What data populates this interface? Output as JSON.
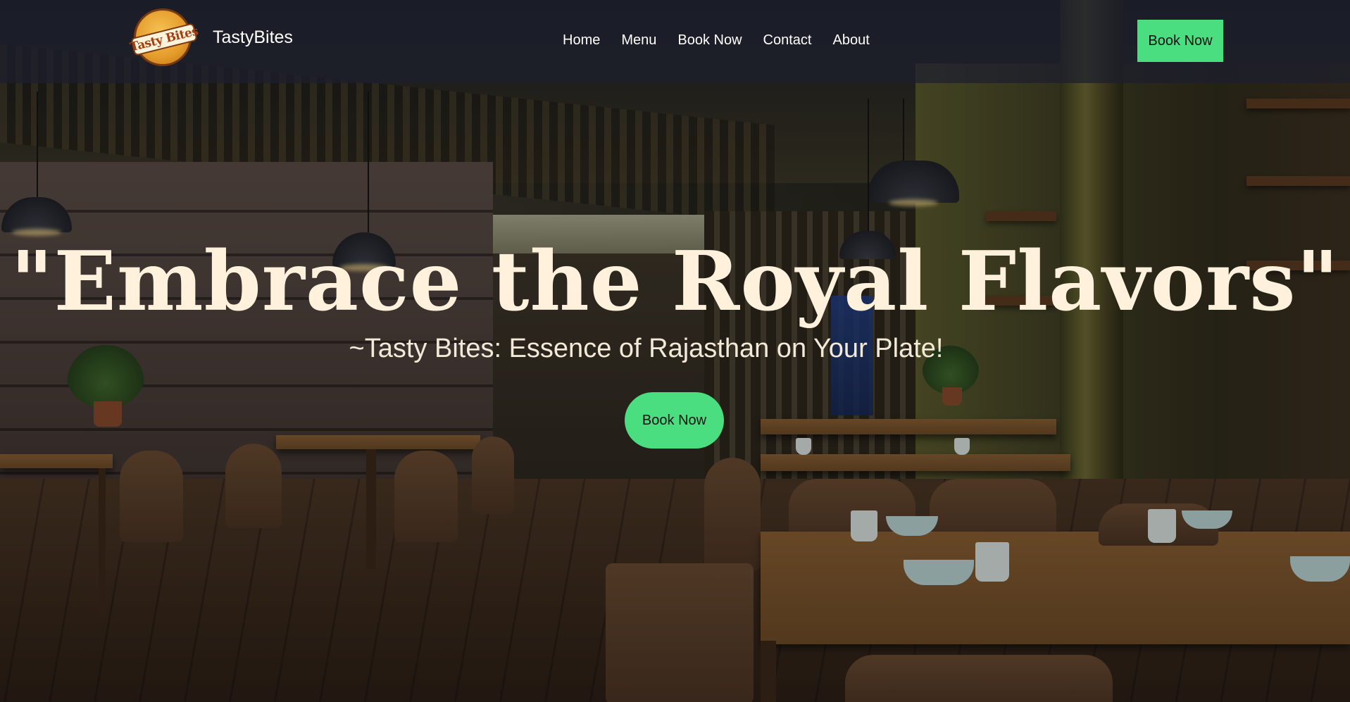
{
  "brand": {
    "logo_text": "Tasty Bites",
    "name": "TastyBites"
  },
  "nav": {
    "links": [
      "Home",
      "Menu",
      "Book Now",
      "Contact",
      "About"
    ],
    "cta_label": "Book Now"
  },
  "hero": {
    "headline": "\"Embrace the Royal Flavors\"",
    "subheadline": "~Tasty Bites: Essence of Rajasthan on Your Plate!",
    "cta_label": "Book Now"
  },
  "colors": {
    "accent": "#4ade80",
    "headline": "#fff1dc",
    "navbar": "#1c1e2e"
  }
}
